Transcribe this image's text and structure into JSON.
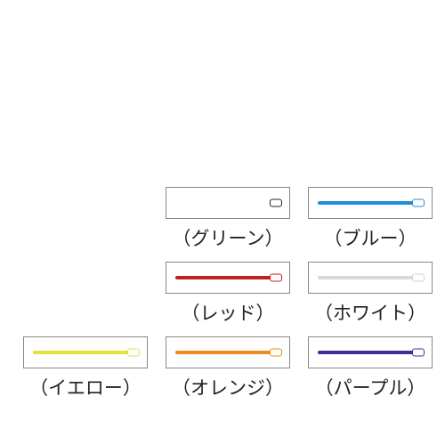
{
  "rows": [
    [
      {
        "key": "green",
        "label": "（グリーン）",
        "color": "#0a8a3a"
      },
      {
        "key": "blue",
        "label": "（ブルー）",
        "color": "#1f8ed6"
      }
    ],
    [
      {
        "key": "red",
        "label": "（レッド）",
        "color": "#c21f1f"
      },
      {
        "key": "white",
        "label": "（ホワイト）",
        "color": "#d9d9d9"
      }
    ],
    [
      {
        "key": "yellow",
        "label": "（イエロー）",
        "color": "#e3e23a"
      },
      {
        "key": "orange",
        "label": "（オレンジ）",
        "color": "#f08a1d"
      },
      {
        "key": "purple",
        "label": "（パープル）",
        "color": "#3a2f9c"
      }
    ]
  ]
}
